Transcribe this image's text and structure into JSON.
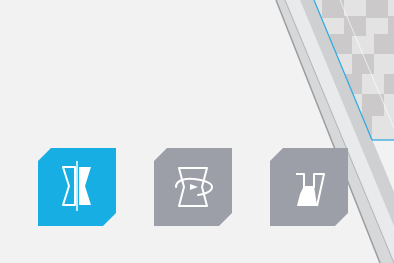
{
  "toolbar": {
    "tools": [
      {
        "id": "mirror",
        "icon": "mirror-icon",
        "active": true
      },
      {
        "id": "rotate",
        "icon": "rotate-icon",
        "active": false
      },
      {
        "id": "lay-flat",
        "icon": "lay-flat-icon",
        "active": false
      }
    ]
  },
  "colors": {
    "active": "#17aee3",
    "inactive": "#9c9ea8",
    "background": "#f2f2f3",
    "bed_edge": "#29a9e0",
    "checker_dark": "#c8c6c6",
    "checker_light": "#e2e1e1"
  }
}
